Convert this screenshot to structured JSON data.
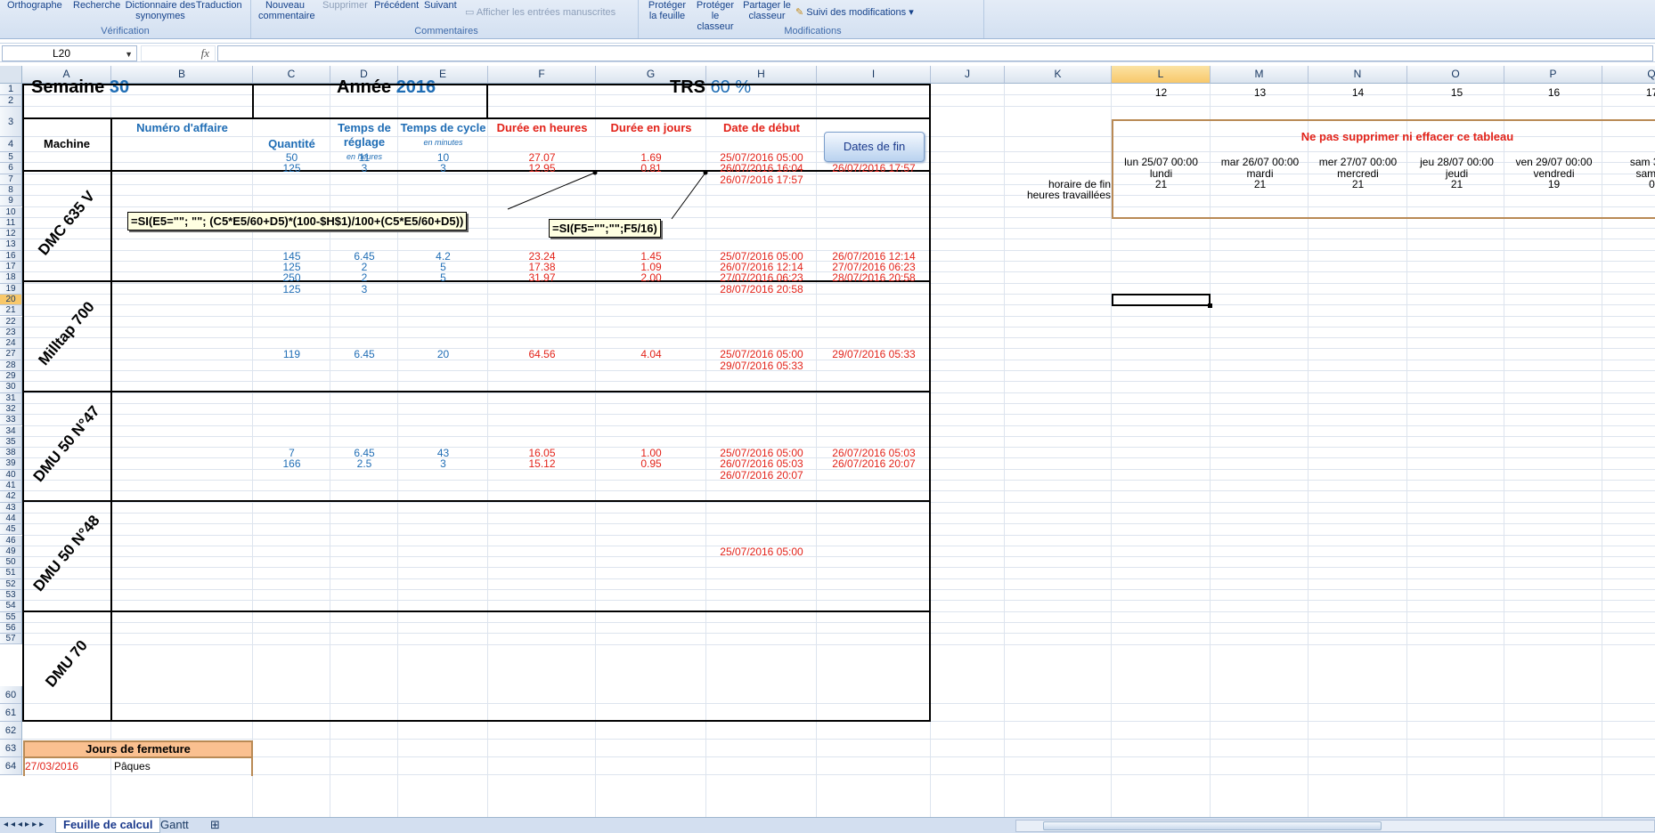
{
  "ribbon": {
    "groups": [
      {
        "title": "Vérification",
        "items": [
          "Orthographe",
          "Recherche",
          "Dictionnaire des synonymes",
          "Traduction"
        ]
      },
      {
        "title": "Commentaires",
        "items": [
          "Nouveau commentaire",
          "Supprimer",
          "Précédent",
          "Suivant",
          "Afficher les entrées manuscrites"
        ]
      },
      {
        "title": "Modifications",
        "items": [
          "Protéger la feuille",
          "Protéger le classeur",
          "Partager le classeur",
          "Suivi des modifications"
        ]
      }
    ]
  },
  "formula_bar": {
    "name_box": "L20",
    "fx": "fx",
    "content": ""
  },
  "columns": [
    "A",
    "B",
    "C",
    "D",
    "E",
    "F",
    "G",
    "H",
    "I",
    "J",
    "K",
    "L",
    "M",
    "N",
    "O",
    "P",
    "Q"
  ],
  "rows": [
    "1",
    "2",
    "3",
    "4",
    "5",
    "6",
    "7",
    "8",
    "9",
    "10",
    "11",
    "12",
    "13",
    "16",
    "17",
    "18",
    "19",
    "20",
    "21",
    "22",
    "23",
    "24",
    "27",
    "28",
    "29",
    "30",
    "31",
    "32",
    "33",
    "34",
    "35",
    "38",
    "39",
    "40",
    "41",
    "42",
    "43",
    "44",
    "45",
    "46",
    "49",
    "50",
    "51",
    "52",
    "53",
    "54",
    "55",
    "56",
    "57",
    "60",
    "61",
    "62",
    "63",
    "64"
  ],
  "header": {
    "semaine_label": "Semaine",
    "semaine": "30",
    "annee_label": "Année",
    "annee": "2016",
    "trs_label": "TRS",
    "trs": "60 %",
    "col_machine": "Machine",
    "col_affaire": "Numéro d'affaire",
    "col_quantite": "Quantité",
    "col_reglage": "Temps de réglage",
    "col_reglage_unit": "en heures",
    "col_cycle": "Temps de cycle",
    "col_cycle_unit": "en minutes",
    "col_duree_h": "Durée en heures",
    "col_duree_j": "Durée en jours",
    "col_debut": "Date de début",
    "btn_fin": "Dates de fin"
  },
  "machines": [
    "DMC 635 V",
    "Milltap 700",
    "DMU 50 N°47",
    "DMU 50 N°48",
    "DMU 70"
  ],
  "data_rows": [
    {
      "qty": "50",
      "reg": "11",
      "cyc": "10",
      "dh": "27.07",
      "dj": "1.69",
      "deb": "25/07/2016 05:00",
      "fin": "26/07/2016 16:04"
    },
    {
      "qty": "125",
      "reg": "3",
      "cyc": "3",
      "dh": "12.95",
      "dj": "0.81",
      "deb": "26/07/2016 16:04",
      "fin": "26/07/2016 17:57"
    },
    {
      "qty": "",
      "reg": "",
      "cyc": "",
      "dh": "",
      "dj": "",
      "deb": "26/07/2016 17:57",
      "fin": ""
    },
    {
      "qty": "145",
      "reg": "6.45",
      "cyc": "4.2",
      "dh": "23.24",
      "dj": "1.45",
      "deb": "25/07/2016 05:00",
      "fin": "26/07/2016 12:14"
    },
    {
      "qty": "125",
      "reg": "2",
      "cyc": "5",
      "dh": "17.38",
      "dj": "1.09",
      "deb": "26/07/2016 12:14",
      "fin": "27/07/2016 06:23"
    },
    {
      "qty": "250",
      "reg": "2",
      "cyc": "5",
      "dh": "31.97",
      "dj": "2.00",
      "deb": "27/07/2016 06:23",
      "fin": "28/07/2016 20:58"
    },
    {
      "qty": "125",
      "reg": "3",
      "cyc": "",
      "dh": "",
      "dj": "",
      "deb": "28/07/2016 20:58",
      "fin": ""
    },
    {
      "qty": "119",
      "reg": "6.45",
      "cyc": "20",
      "dh": "64.56",
      "dj": "4.04",
      "deb": "25/07/2016 05:00",
      "fin": "29/07/2016 05:33"
    },
    {
      "qty": "",
      "reg": "",
      "cyc": "",
      "dh": "",
      "dj": "",
      "deb": "29/07/2016 05:33",
      "fin": ""
    },
    {
      "qty": "7",
      "reg": "6.45",
      "cyc": "43",
      "dh": "16.05",
      "dj": "1.00",
      "deb": "25/07/2016 05:00",
      "fin": "26/07/2016 05:03"
    },
    {
      "qty": "166",
      "reg": "2.5",
      "cyc": "3",
      "dh": "15.12",
      "dj": "0.95",
      "deb": "26/07/2016 05:03",
      "fin": "26/07/2016 20:07"
    },
    {
      "qty": "",
      "reg": "",
      "cyc": "",
      "dh": "",
      "dj": "",
      "deb": "26/07/2016 20:07",
      "fin": ""
    },
    {
      "qty": "",
      "reg": "",
      "cyc": "",
      "dh": "",
      "dj": "",
      "deb": "25/07/2016 05:00",
      "fin": ""
    }
  ],
  "comments": {
    "c1": "=SI(E5=\"\"; \"\"; (C5*E5/60+D5)*(100-$H$1)/100+(C5*E5/60+D5))",
    "c2": "=SI(F5=\"\";\"\";F5/16)"
  },
  "right_table": {
    "week_numbers": [
      "12",
      "13",
      "14",
      "15",
      "16",
      "17"
    ],
    "warning": "Ne pas supprimer ni effacer ce tableau",
    "dates": [
      "lun 25/07 00:00",
      "mar 26/07 00:00",
      "mer 27/07 00:00",
      "jeu 28/07 00:00",
      "ven 29/07 00:00",
      "sam 30/0"
    ],
    "days": [
      "lundi",
      "mardi",
      "mercredi",
      "jeudi",
      "vendredi",
      "samed"
    ],
    "hours": [
      "21",
      "21",
      "21",
      "21",
      "19",
      "0"
    ],
    "label_horaire": "horaire de fin",
    "label_heures": "heures travaillées"
  },
  "fermeture": {
    "title": "Jours de fermeture",
    "rows": [
      {
        "date": "27/03/2016",
        "label": "Pâques"
      }
    ]
  },
  "tabs": [
    "Feuille de calcul",
    "Gantt"
  ]
}
